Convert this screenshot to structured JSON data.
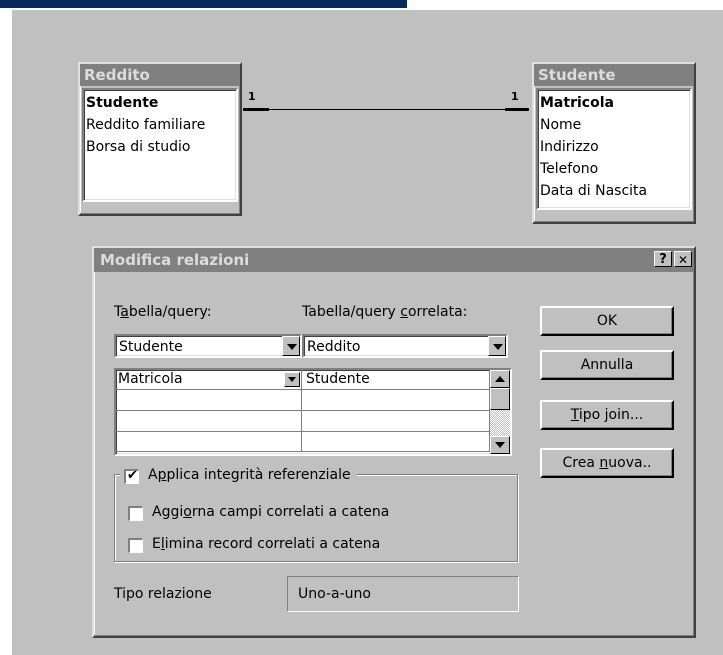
{
  "tables": {
    "left": {
      "title": "Reddito",
      "fields": [
        "Studente",
        "Reddito familiare",
        "Borsa di studio"
      ]
    },
    "right": {
      "title": "Studente",
      "fields": [
        "Matricola",
        "Nome",
        "Indirizzo",
        "Telefono",
        "Data di Nascita"
      ]
    },
    "relationship": {
      "left_cardinality": "1",
      "right_cardinality": "1"
    }
  },
  "dialog": {
    "title": "Modifica relazioni",
    "help_button": "?",
    "close_button": "✕",
    "table_label": {
      "pre": "T",
      "u": "a",
      "post": "bella/query:"
    },
    "related_label": {
      "pre": "Tabella/query ",
      "u": "c",
      "post": "orrelata:"
    },
    "table_value": "Studente",
    "related_value": "Reddito",
    "fields_grid": {
      "rows": [
        {
          "left": "Matricola",
          "right": "Studente"
        },
        {
          "left": "",
          "right": ""
        },
        {
          "left": "",
          "right": ""
        },
        {
          "left": "",
          "right": ""
        }
      ]
    },
    "buttons": {
      "ok": "OK",
      "cancel": "Annulla",
      "join": {
        "u": "T",
        "post": "ipo join..."
      },
      "new": {
        "pre": "Crea ",
        "u": "n",
        "post": "uova.."
      }
    },
    "enforce": {
      "pre": "A",
      "u": "p",
      "post": "plica integrità referenziale",
      "checked": true
    },
    "cascade_update": {
      "pre": "Aggi",
      "u": "o",
      "post": "rna campi correlati a catena",
      "checked": false
    },
    "cascade_delete": {
      "pre": "E",
      "u": "l",
      "post": "imina record correlati a catena",
      "checked": false
    },
    "relation_type_label": "Tipo relazione",
    "relation_type_value": "Uno-a-uno"
  }
}
